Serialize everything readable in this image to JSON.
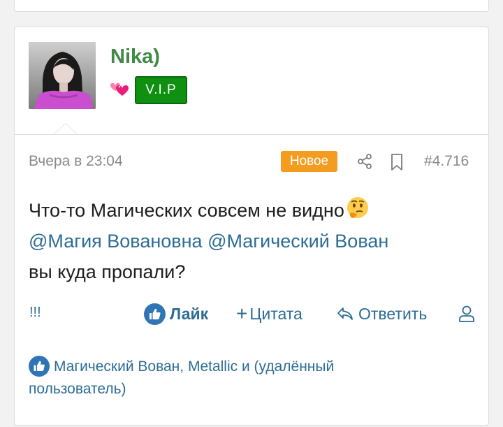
{
  "author": {
    "username": "Nika)",
    "badge": "V.I.P",
    "username_color": "#3f8a45",
    "badge_color": "#109010"
  },
  "meta": {
    "timestamp": "Вчера в 23:04",
    "new_badge": "Новое",
    "post_number": "#4.716"
  },
  "message": {
    "line1": "Что-то Магических совсем не видно",
    "mention1": "@Магия Вовановна",
    "mention2": "@Магический Вован",
    "line3": "вы куда пропали?"
  },
  "actions": {
    "report": "!!!",
    "like": "Лайк",
    "quote": "Цитата",
    "reply": "Ответить"
  },
  "likes": {
    "text": "Магический Вован, Metallic и (удалённый пользователь)"
  },
  "colors": {
    "link": "#2c6c95",
    "new_badge": "#f39c1f",
    "meta_text": "#8a8a8a"
  }
}
